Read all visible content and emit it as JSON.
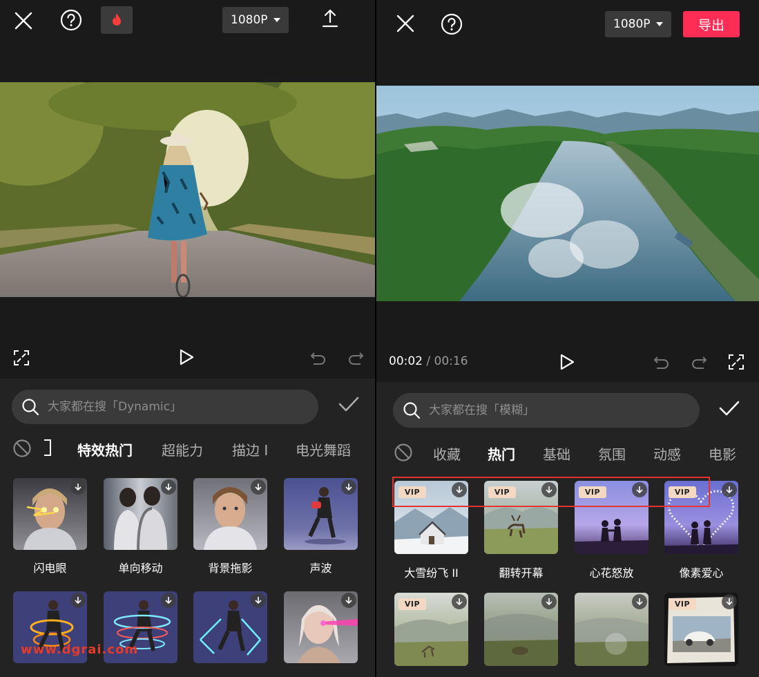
{
  "left": {
    "top": {
      "resolution": "1080P"
    },
    "search": {
      "placeholder": "大家都在搜「Dynamic」"
    },
    "tabs": [
      {
        "label": "特效热门",
        "active": true
      },
      {
        "label": "超能力",
        "active": false
      },
      {
        "label": "描边 I",
        "active": false
      },
      {
        "label": "电光舞蹈",
        "active": false
      }
    ],
    "effects": [
      {
        "label": "闪电眼"
      },
      {
        "label": "单向移动"
      },
      {
        "label": "背景拖影"
      },
      {
        "label": "声波"
      }
    ]
  },
  "right": {
    "top": {
      "resolution": "1080P",
      "export_label": "导出"
    },
    "time": {
      "current": "00:02",
      "separator": " / ",
      "total": "00:16"
    },
    "search": {
      "placeholder": "大家都在搜「模糊」"
    },
    "tabs": [
      {
        "label": "收藏",
        "active": false
      },
      {
        "label": "热门",
        "active": true
      },
      {
        "label": "基础",
        "active": false
      },
      {
        "label": "氛围",
        "active": false
      },
      {
        "label": "动感",
        "active": false
      },
      {
        "label": "电影",
        "active": false
      }
    ],
    "vip_badge": "VIP",
    "effects": [
      {
        "label": "大雪纷飞 II"
      },
      {
        "label": "翻转开幕"
      },
      {
        "label": "心花怒放"
      },
      {
        "label": "像素爱心"
      }
    ]
  },
  "watermark": "www.dgrai.com",
  "colors": {
    "accent": "#fd2d55",
    "highlight": "#e3342f"
  }
}
